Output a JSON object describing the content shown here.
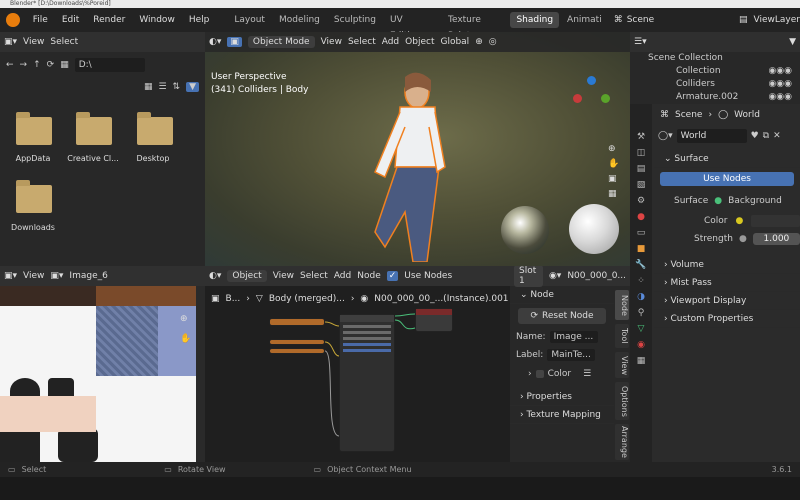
{
  "titlebar": {
    "text": "Blender* [D:\\Downloads\\%Poreid]"
  },
  "menu": {
    "file": "File",
    "edit": "Edit",
    "render": "Render",
    "window": "Window",
    "help": "Help"
  },
  "workspaces": [
    "Layout",
    "Modeling",
    "Sculpting",
    "UV Editing",
    "Texture Paint",
    "Shading",
    "Animati"
  ],
  "scene": "Scene",
  "viewlayer": "ViewLayer",
  "filebrowser": {
    "view": "View",
    "select": "Select",
    "path": "D:\\",
    "folders": [
      {
        "name": "AppData"
      },
      {
        "name": "Creative Cl..."
      },
      {
        "name": "Desktop"
      },
      {
        "name": "Downloads"
      }
    ]
  },
  "viewport": {
    "mode": "Object Mode",
    "view": "View",
    "select": "Select",
    "add": "Add",
    "object": "Object",
    "transform": "Global",
    "perspective": "User Perspective",
    "collection": "(341) Colliders | Body"
  },
  "outliner": {
    "title": "Scene Collection",
    "items": [
      {
        "name": "Collection"
      },
      {
        "name": "Colliders"
      },
      {
        "name": "Armature.002"
      }
    ]
  },
  "properties": {
    "breadcrumb_scene": "Scene",
    "breadcrumb_world": "World",
    "world_name": "World",
    "surface": "Surface",
    "use_nodes": "Use Nodes",
    "surface_label": "Surface",
    "background": "Background",
    "color_label": "Color",
    "strength_label": "Strength",
    "strength": "1.000",
    "volume": "Volume",
    "mist": "Mist Pass",
    "viewport_display": "Viewport Display",
    "custom_props": "Custom Properties"
  },
  "imageeditor": {
    "view": "View",
    "image": "Image_6"
  },
  "nodeeditor": {
    "object": "Object",
    "view": "View",
    "select": "Select",
    "add": "Add",
    "node": "Node",
    "use_nodes": "Use Nodes",
    "slot": "Slot 1",
    "material": "N00_000_0...",
    "breadcrumb_b": "B...",
    "breadcrumb_body": "Body (merged)...",
    "breadcrumb_mat": "N00_000_00_...(Instance).001"
  },
  "nodepanel": {
    "title": "Node",
    "reset": "Reset Node",
    "name_label": "Name:",
    "name_value": "Image ...",
    "label_label": "Label:",
    "label_value": "MainTe...",
    "color": "Color",
    "properties": "Properties",
    "texture_mapping": "Texture Mapping",
    "tabs": [
      "Node",
      "Tool",
      "View",
      "Options",
      "Arrange"
    ]
  },
  "status": {
    "select": "Select",
    "rotate": "Rotate View",
    "context": "Object Context Menu",
    "version": "3.6.1"
  }
}
